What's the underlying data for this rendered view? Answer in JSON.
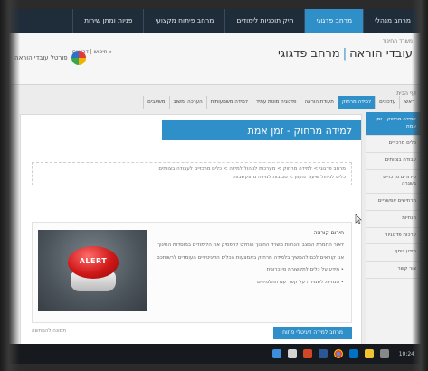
{
  "topnav": {
    "tabs": [
      {
        "label": "מרחב מנהלי",
        "active": false
      },
      {
        "label": "מרחב פדגוגי",
        "active": true
      },
      {
        "label": "תיק תוכניות לימודים",
        "active": false
      },
      {
        "label": "מרחב פיתוח מקצועי",
        "active": false
      },
      {
        "label": "פניות ומתן שירות",
        "active": false
      }
    ]
  },
  "header": {
    "breadcrumb": "משרד החינוך",
    "title_part1": "עובדי הוראה",
    "title_separator": "|",
    "title_part2": "מרחב פדגוגי",
    "links": "חיפוש | דרושים",
    "logo_text": "פורטל עובדי הוראה"
  },
  "subnav": {
    "items": [
      {
        "label": "ראשי",
        "active": false
      },
      {
        "label": "עדכונים",
        "active": false
      },
      {
        "label": "למידה מרחוק",
        "active": true
      },
      {
        "label": "תעודת הוראה",
        "active": false
      },
      {
        "label": "פדגוגיה מוטת עתיד",
        "active": false
      },
      {
        "label": "למידה משמעותית",
        "active": false
      },
      {
        "label": "הערכה ומשוב",
        "active": false
      },
      {
        "label": "משאבים",
        "active": false
      }
    ]
  },
  "sidebar": {
    "head": "דף הבית",
    "items": [
      {
        "label": "למידה מרחוק - זמן אמת",
        "active": true
      },
      {
        "label": "כלים מרכזיים",
        "active": false
      },
      {
        "label": "עבודה בצוותים",
        "active": false
      },
      {
        "label": "סידורים מרכזיים בשגרה",
        "active": false
      },
      {
        "label": "תרחישים אפשריים",
        "active": false
      },
      {
        "label": "הנחיות",
        "active": false
      },
      {
        "label": "ערכות פדגוגיות",
        "active": false
      },
      {
        "label": "מידע נוסף",
        "active": false
      },
      {
        "label": "צור קשר",
        "active": false
      }
    ]
  },
  "main": {
    "banner_title": "למידה מרחוק - זמן אמת",
    "crumbs_line1": "מרחב פדגוגי > למידה מרחוק > מערכות לניהול למידה > כלים מרכזיים לעבודה בצוותים",
    "crumbs_line2": "כלים לניהול שיעור מקוון > סביבות למידה מתוקשבות",
    "content_heading": "חירום קורונה",
    "para1": "לאור החמרת המצב והנחיות משרד החינוך הוחלט להפסיק את הלימודים במוסדות החינוך",
    "para2": "אנו קוראים לכם להמשיך בלמידה מרחוק באמצעות הכלים הדיגיטליים העומדים לרשותכם",
    "para3": "• מידע על כלים לתקשורת סינכרונית",
    "para4": "• הנחיות לשמירה על קשר עם התלמידים",
    "footer_button": "מרחב למידה דיגיטלי פתוח",
    "footer_right": "תמונה להמחשה",
    "alert_label": "ALERT"
  },
  "taskbar": {
    "clock": "10:24"
  },
  "colors": {
    "accent": "#2f8fc8",
    "topnav_bg": "#1f2d3a",
    "alert_red": "#d01818"
  }
}
